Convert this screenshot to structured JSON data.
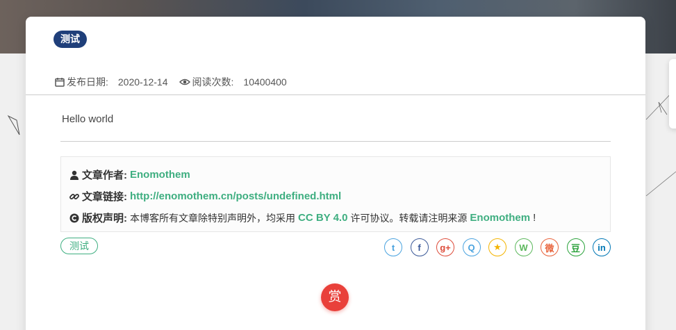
{
  "post": {
    "category_badge": "测试",
    "publish_label": "发布日期:",
    "publish_date": "2020-12-14",
    "views_label": "阅读次数:",
    "views_count": "10400400",
    "content": "Hello world"
  },
  "copyright": {
    "author_label": "文章作者:",
    "author": "Enomothem",
    "link_label": "文章链接:",
    "link": "http://enomothem.cn/posts/undefined.html",
    "license_label": "版权声明:",
    "license_text_1": "本博客所有文章除特别声明外，均采用",
    "license_name": "CC BY 4.0",
    "license_text_2": "许可协议。转载请注明来源",
    "license_source": "Enomothem",
    "license_end": "!"
  },
  "tags": [
    "测试"
  ],
  "share": [
    {
      "name": "twitter-icon",
      "glyph": "t",
      "color": "#4aa3df"
    },
    {
      "name": "facebook-icon",
      "glyph": "f",
      "color": "#3b5998"
    },
    {
      "name": "google-plus-icon",
      "glyph": "g+",
      "color": "#dd4b39"
    },
    {
      "name": "qq-icon",
      "glyph": "Q",
      "color": "#4aa3df"
    },
    {
      "name": "qzone-icon",
      "glyph": "★",
      "color": "#f4b400"
    },
    {
      "name": "wechat-icon",
      "glyph": "W",
      "color": "#5cb85c"
    },
    {
      "name": "weibo-icon",
      "glyph": "微",
      "color": "#e8623a"
    },
    {
      "name": "douban-icon",
      "glyph": "豆",
      "color": "#2ca33c"
    },
    {
      "name": "linkedin-icon",
      "glyph": "in",
      "color": "#0077b5"
    }
  ],
  "reward": {
    "label": "赏"
  }
}
